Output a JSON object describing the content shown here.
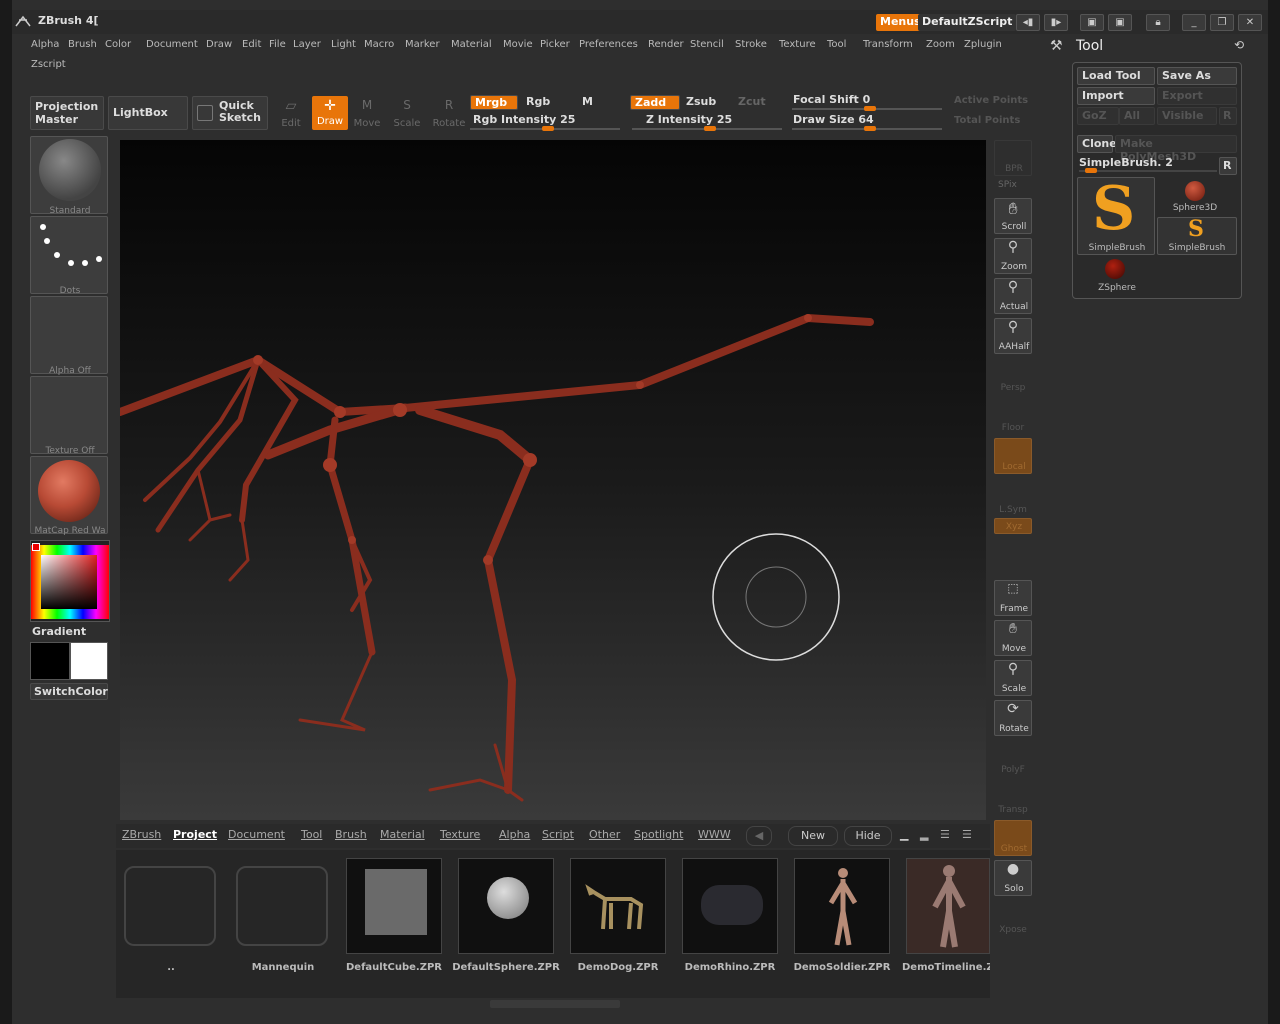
{
  "window": {
    "title": "ZBrush 4[",
    "menus_button": "Menus",
    "script_button": "DefaultZScript"
  },
  "menubar": {
    "items": [
      "Alpha",
      "Brush",
      "Color",
      "Document",
      "Draw",
      "Edit",
      "File",
      "Layer",
      "Light",
      "Macro",
      "Marker",
      "Material",
      "Movie",
      "Picker",
      "Preferences",
      "Render",
      "Stencil",
      "Stroke",
      "Texture",
      "Tool",
      "Transform",
      "Zoom",
      "Zplugin"
    ],
    "second_row": [
      "Zscript"
    ]
  },
  "toolbar": {
    "projection_master_1": "Projection",
    "projection_master_2": "Master",
    "lightbox": "LightBox",
    "quick_sketch_1": "Quick",
    "quick_sketch_2": "Sketch",
    "edit": "Edit",
    "draw": "Draw",
    "move": "Move",
    "scale": "Scale",
    "rotate": "Rotate",
    "mrgb": "Mrgb",
    "rgb": "Rgb",
    "m": "M",
    "zadd": "Zadd",
    "zsub": "Zsub",
    "zcut": "Zcut",
    "rgb_intensity": "Rgb Intensity 25",
    "z_intensity": "Z Intensity 25",
    "focal_shift": "Focal Shift 0",
    "draw_size": "Draw Size 64",
    "active_points": "Active Points",
    "total_points": "Total Points"
  },
  "leftcol": {
    "brush": "Standard",
    "stroke": "Dots",
    "alpha": "Alpha Off",
    "texture": "Texture Off",
    "material": "MatCap Red Wa",
    "gradient": "Gradient",
    "switchcolor": "SwitchColor",
    "colors": {
      "primary": "#000000",
      "secondary": "#ffffff",
      "material": "#b84a35"
    }
  },
  "rightshelf": {
    "items": [
      "SPix",
      "Scroll",
      "Zoom",
      "Actual",
      "AAHalf",
      "Persp",
      "Floor",
      "Local",
      "L.Sym",
      "Xyz",
      "Frame",
      "Move",
      "Scale",
      "Rotate",
      "PolyF",
      "Transp",
      "Ghost",
      "Solo",
      "Xpose"
    ],
    "bpr": "BPR"
  },
  "bottom": {
    "tabs": [
      "ZBrush",
      "Project",
      "Document",
      "Tool",
      "Brush",
      "Material",
      "Texture",
      "Alpha",
      "Script",
      "Other",
      "Spotlight",
      "WWW"
    ],
    "active_tab": "Project",
    "new_label": "New",
    "hide_label": "Hide",
    "files": [
      "..",
      "Mannequin",
      "DefaultCube.ZPR",
      "DefaultSphere.ZPR",
      "DemoDog.ZPR",
      "DemoRhino.ZPR",
      "DemoSoldier.ZPR",
      "DemoTimeline.ZPR"
    ]
  },
  "toolpanel": {
    "title": "Tool",
    "load_tool": "Load Tool",
    "save_as": "Save As",
    "import": "Import",
    "export": "Export",
    "goz": "GoZ",
    "all": "All",
    "visible": "Visible",
    "r": "R",
    "clone": "Clone",
    "make_polymesh": "Make PolyMesh3D",
    "brush_name": "SimpleBrush. 2",
    "tools": [
      "SimpleBrush",
      "Sphere3D",
      "SimpleBrush",
      "ZSphere"
    ]
  },
  "accent": "#e8750a"
}
